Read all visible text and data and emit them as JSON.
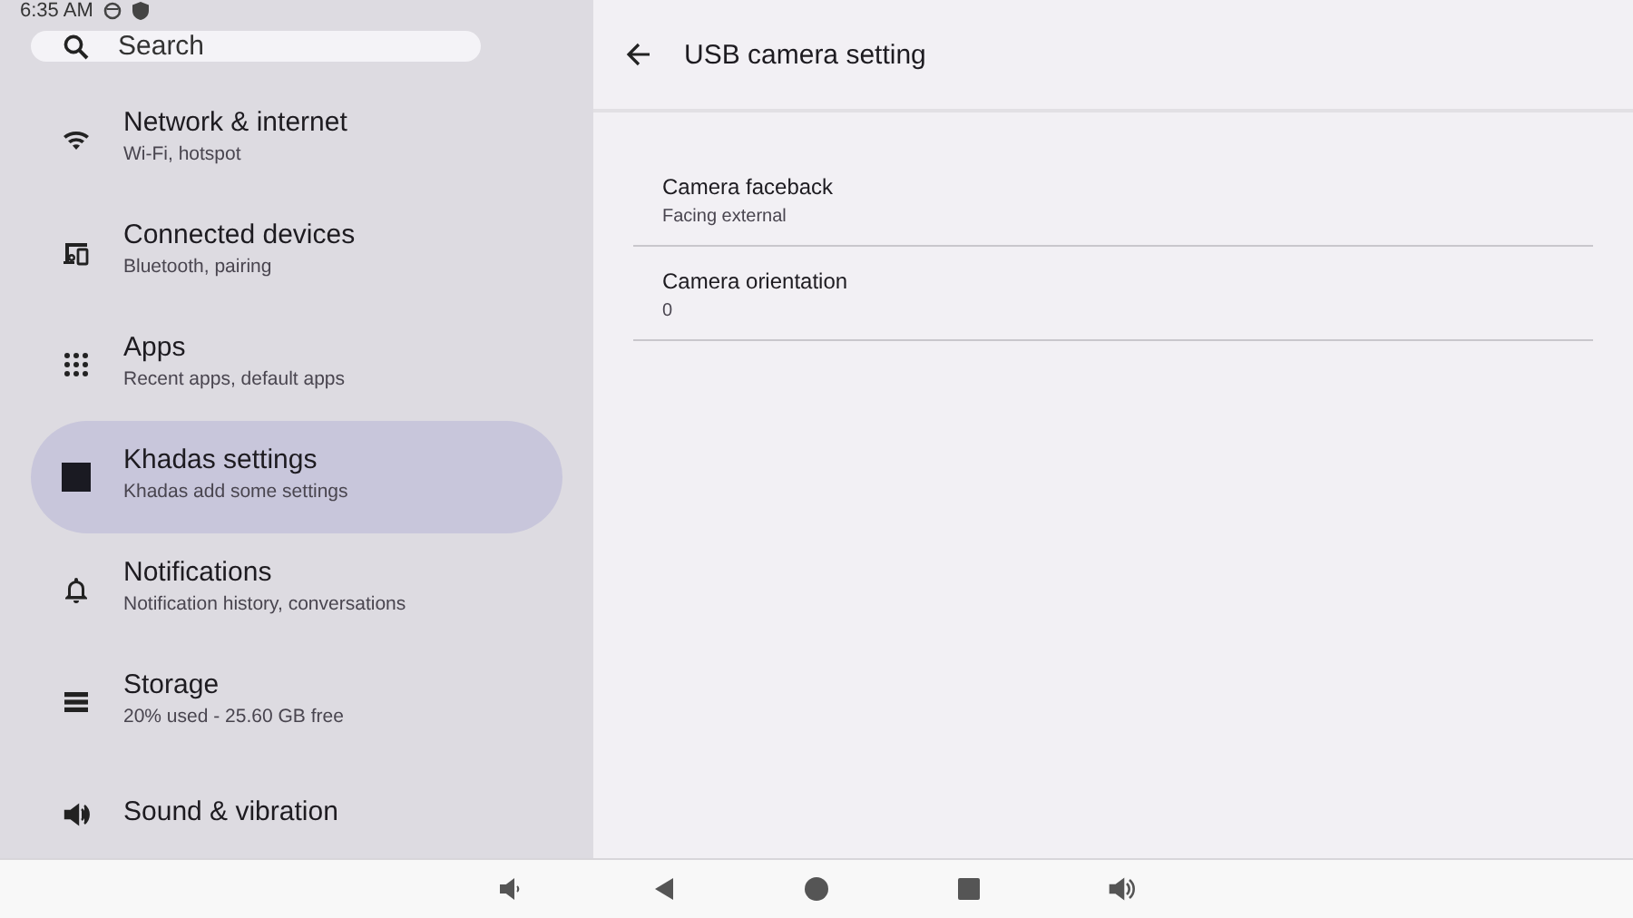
{
  "status_bar": {
    "time": "6:35 AM"
  },
  "search": {
    "placeholder": "Search"
  },
  "sidebar": {
    "items": [
      {
        "title": "Network & internet",
        "subtitle": "Wi-Fi, hotspot",
        "selected": false
      },
      {
        "title": "Connected devices",
        "subtitle": "Bluetooth, pairing",
        "selected": false
      },
      {
        "title": "Apps",
        "subtitle": "Recent apps, default apps",
        "selected": false
      },
      {
        "title": "Khadas settings",
        "subtitle": "Khadas add some settings",
        "selected": true
      },
      {
        "title": "Notifications",
        "subtitle": "Notification history, conversations",
        "selected": false
      },
      {
        "title": "Storage",
        "subtitle": "20% used - 25.60 GB free",
        "selected": false
      },
      {
        "title": "Sound & vibration",
        "selected": false
      }
    ]
  },
  "page": {
    "title": "USB camera setting",
    "settings": [
      {
        "title": "Camera faceback",
        "value": "Facing external"
      },
      {
        "title": "Camera orientation",
        "value": "0"
      }
    ]
  }
}
